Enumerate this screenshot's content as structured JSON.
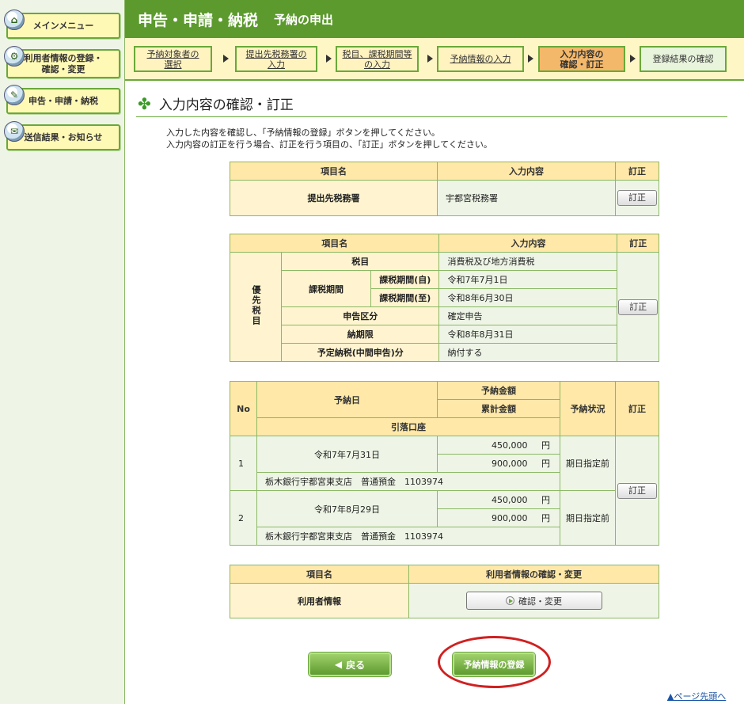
{
  "sidebar": {
    "items": [
      {
        "label": "メインメニュー",
        "icon": "home-icon"
      },
      {
        "label": "利用者情報の登録・確認・変更",
        "label_line1": "利用者情報の登録・",
        "label_line2": "確認・変更",
        "icon": "gear-icon"
      },
      {
        "label": "申告・申請・納税",
        "icon": "document-icon"
      },
      {
        "label": "送信結果・お知らせ",
        "icon": "mail-icon"
      }
    ]
  },
  "header": {
    "title": "申告・申請・納税",
    "subtitle": "予納の申出"
  },
  "steps": [
    {
      "line1": "予納対象者の",
      "line2": "選択"
    },
    {
      "line1": "提出先税務署の",
      "line2": "入力"
    },
    {
      "line1": "税目、課税期間等",
      "line2": "の入力"
    },
    {
      "line1": "予納情報の入力",
      "line2": ""
    },
    {
      "line1": "入力内容の",
      "line2": "確認・訂正"
    },
    {
      "line1": "登録結果の確認",
      "line2": ""
    }
  ],
  "section_title": "入力内容の確認・訂正",
  "description": {
    "line1": "入力した内容を確認し、「予納情報の登録」ボタンを押してください。",
    "line2": "入力内容の訂正を行う場合、訂正を行う項目の、「訂正」ボタンを押してください。"
  },
  "table1": {
    "headers": {
      "item": "項目名",
      "content": "入力内容",
      "edit": "訂正"
    },
    "label": "提出先税務署",
    "value": "宇都宮税務署",
    "edit_label": "訂正"
  },
  "table2": {
    "headers": {
      "item": "項目名",
      "content": "入力内容",
      "edit": "訂正"
    },
    "group_label": "優先税目",
    "rows": {
      "tax_item": {
        "label": "税目",
        "value": "消費税及び地方消費税"
      },
      "period": {
        "label": "課税期間"
      },
      "period_from": {
        "label": "課税期間(自)",
        "value": "令和7年7月1日"
      },
      "period_to": {
        "label": "課税期間(至)",
        "value": "令和8年6月30日"
      },
      "declaration": {
        "label": "申告区分",
        "value": "確定申告"
      },
      "deadline": {
        "label": "納期限",
        "value": "令和8年8月31日"
      },
      "interim": {
        "label": "予定納税(中間申告)分",
        "value": "納付する"
      }
    },
    "edit_label": "訂正"
  },
  "table3": {
    "headers": {
      "no": "No",
      "date": "予納日",
      "amount": "予納金額",
      "cumulative": "累計金額",
      "status": "予納状況",
      "edit": "訂正",
      "account": "引落口座"
    },
    "rows": [
      {
        "no": "1",
        "date": "令和7年7月31日",
        "amount": "450,000",
        "cumulative": "900,000",
        "yen": "円",
        "status": "期日指定前",
        "account": "栃木銀行宇都宮東支店　普通預金　1103974"
      },
      {
        "no": "2",
        "date": "令和7年8月29日",
        "amount": "450,000",
        "cumulative": "900,000",
        "yen": "円",
        "status": "期日指定前",
        "account": "栃木銀行宇都宮東支店　普通預金　1103974"
      }
    ],
    "edit_label": "訂正"
  },
  "table4": {
    "headers": {
      "item": "項目名",
      "action": "利用者情報の確認・変更"
    },
    "label": "利用者情報",
    "button": "確認・変更"
  },
  "buttons": {
    "back": "戻る",
    "register": "予納情報の登録"
  },
  "page_top": "ページ先頭へ"
}
